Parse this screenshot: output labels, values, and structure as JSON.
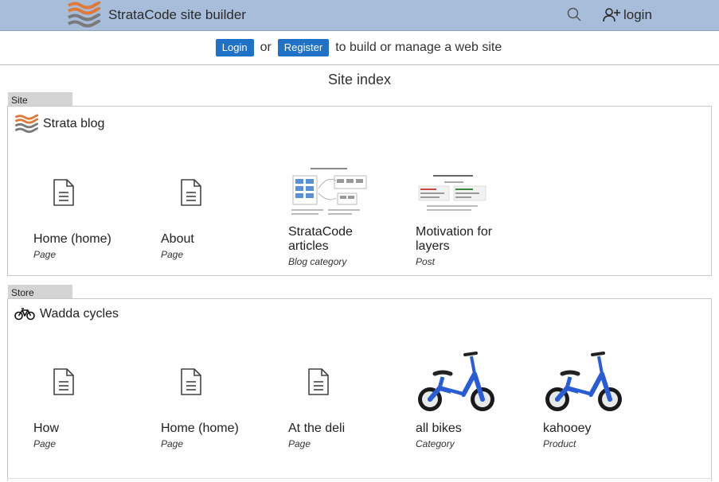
{
  "header": {
    "title": "StrataCode site builder",
    "login_label": "login",
    "logo_icon": "strata-waves-logo",
    "search_icon": "search-icon",
    "login_icon": "add-user-icon"
  },
  "prompt": {
    "login_button": "Login",
    "or_text": "or",
    "register_button": "Register",
    "suffix_text": "to build or manage a web site"
  },
  "page_title": "Site index",
  "sections": [
    {
      "tag": "Site",
      "name": "Strata blog",
      "icon": "strata-waves-icon",
      "items": [
        {
          "name": "Home (home)",
          "type": "Page",
          "thumb": "page-icon"
        },
        {
          "name": "About",
          "type": "Page",
          "thumb": "page-icon"
        },
        {
          "name": "StrataCode articles",
          "type": "Blog category",
          "thumb": "diagram-thumbnail"
        },
        {
          "name": "Motivation for layers",
          "type": "Post",
          "thumb": "document-thumbnail"
        }
      ]
    },
    {
      "tag": "Store",
      "name": "Wadda cycles",
      "icon": "bicycle-icon",
      "items": [
        {
          "name": "How",
          "type": "Page",
          "thumb": "page-icon"
        },
        {
          "name": "Home (home)",
          "type": "Page",
          "thumb": "page-icon"
        },
        {
          "name": "At the deli",
          "type": "Page",
          "thumb": "page-icon"
        },
        {
          "name": "all bikes",
          "type": "Category",
          "thumb": "balance-bike-image"
        },
        {
          "name": "kahooey",
          "type": "Product",
          "thumb": "balance-bike-image"
        }
      ]
    }
  ],
  "colors": {
    "header_bg": "#a8bdd9",
    "button_bg": "#1f72c6",
    "bike_blue": "#2a5cd8"
  }
}
